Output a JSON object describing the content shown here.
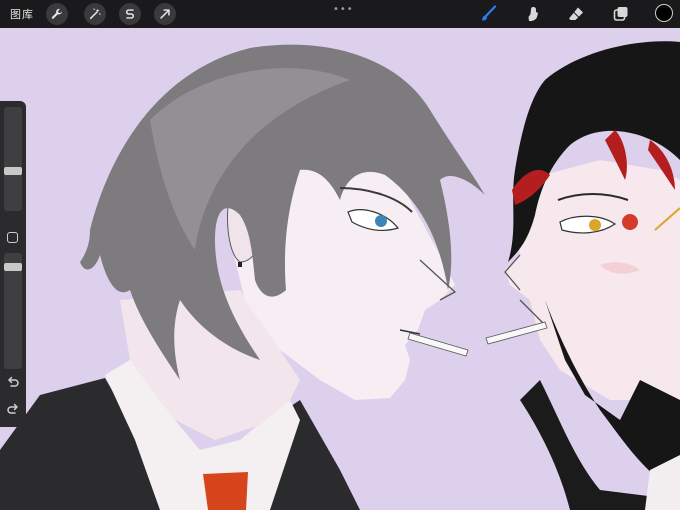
{
  "app": {
    "gallery_label": "图库",
    "toolbar_left": [
      {
        "name": "actions-wrench-icon"
      },
      {
        "name": "adjustments-magic-wand-icon"
      },
      {
        "name": "selection-s-icon"
      },
      {
        "name": "transform-arrow-icon"
      }
    ],
    "more_dots": "•••",
    "toolbar_right": [
      {
        "name": "brush-icon",
        "active": true,
        "color": "#2f7bf5"
      },
      {
        "name": "smudge-icon",
        "active": false
      },
      {
        "name": "eraser-icon",
        "active": false
      },
      {
        "name": "layers-icon",
        "active": false
      }
    ],
    "current_color": "#000000"
  },
  "sidebar": {
    "brush_size": 0.66,
    "opacity": 0.97
  },
  "colors": {
    "toolbar_bg": "#1a1a1c",
    "canvas_bg": "#ddd0ec",
    "accent": "#2f7bf5"
  }
}
